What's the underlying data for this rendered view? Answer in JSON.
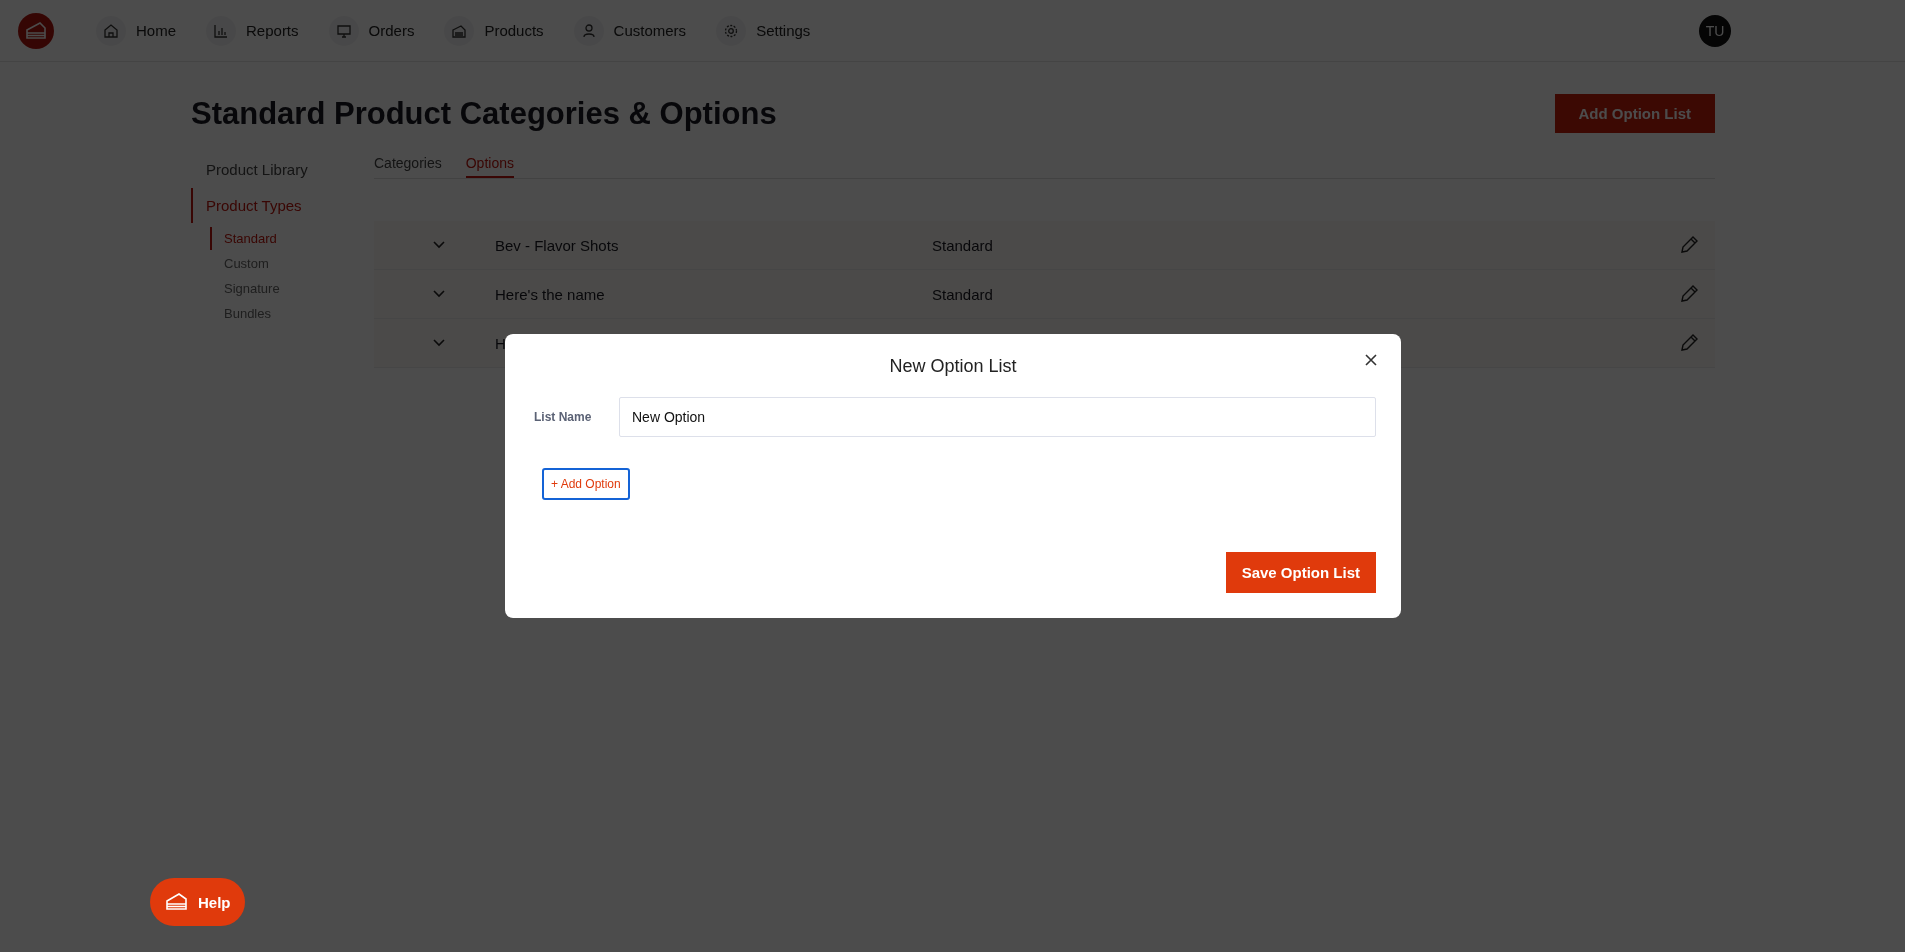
{
  "nav": {
    "items": [
      {
        "label": "Home"
      },
      {
        "label": "Reports"
      },
      {
        "label": "Orders"
      },
      {
        "label": "Products"
      },
      {
        "label": "Customers"
      },
      {
        "label": "Settings"
      }
    ],
    "avatar": "TU"
  },
  "page": {
    "title": "Standard Product Categories & Options",
    "action": "Add Option List"
  },
  "sidebar": {
    "items": [
      {
        "label": "Product Library",
        "selected": false
      },
      {
        "label": "Product Types",
        "selected": true,
        "children": [
          {
            "label": "Standard",
            "selected": true
          },
          {
            "label": "Custom",
            "selected": false
          },
          {
            "label": "Signature",
            "selected": false
          },
          {
            "label": "Bundles",
            "selected": false
          }
        ]
      }
    ]
  },
  "tabs": [
    {
      "label": "Categories",
      "selected": false
    },
    {
      "label": "Options",
      "selected": true
    }
  ],
  "rows": [
    {
      "name": "Bev - Flavor Shots",
      "type": "Standard"
    },
    {
      "name": "Here's the name",
      "type": "Standard"
    },
    {
      "name": "H",
      "type": ""
    }
  ],
  "modal": {
    "title": "New Option List",
    "field_label": "List Name",
    "field_value": "New Option",
    "add_button": "+ Add Option",
    "save_button": "Save Option List"
  },
  "help": {
    "label": "Help"
  }
}
